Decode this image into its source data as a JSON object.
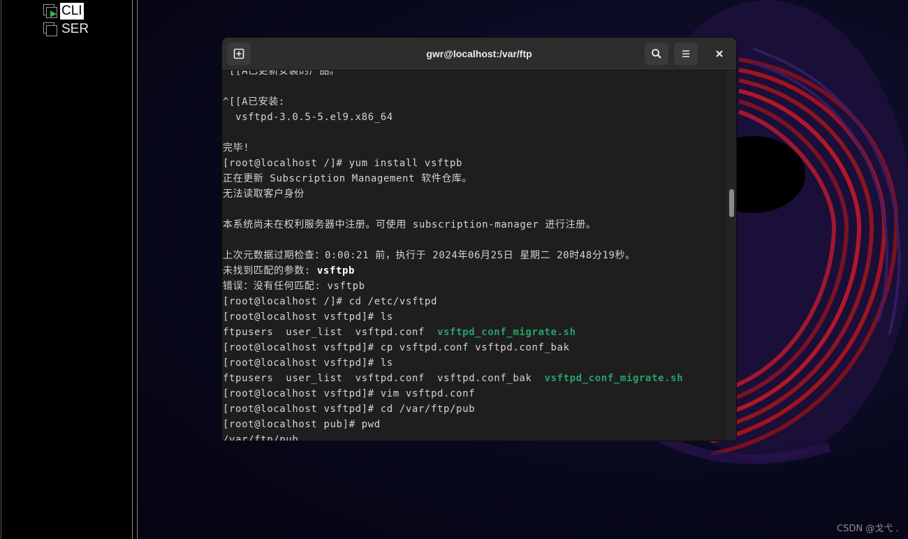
{
  "vm_list": [
    {
      "label": "CLI",
      "selected": true,
      "running": true
    },
    {
      "label": "SER",
      "selected": false,
      "running": false
    }
  ],
  "terminal": {
    "title": "gwr@localhost:/var/ftp",
    "lines": [
      [
        {
          "t": "^[[A已更新安装的产品。"
        }
      ],
      [
        {
          "t": ""
        }
      ],
      [
        {
          "t": "^[[A已安装:"
        }
      ],
      [
        {
          "t": "  vsftpd-3.0.5-5.el9.x86_64"
        }
      ],
      [
        {
          "t": ""
        }
      ],
      [
        {
          "t": "完毕!"
        }
      ],
      [
        {
          "t": "[root@localhost /]# yum install vsftpb"
        }
      ],
      [
        {
          "t": "正在更新 Subscription Management 软件仓库。"
        }
      ],
      [
        {
          "t": "无法读取客户身份"
        }
      ],
      [
        {
          "t": ""
        }
      ],
      [
        {
          "t": "本系统尚未在权利服务器中注册。可使用 subscription-manager 进行注册。"
        }
      ],
      [
        {
          "t": ""
        }
      ],
      [
        {
          "t": "上次元数据过期检查：0:00:21 前，执行于 2024年06月25日 星期二 20时48分19秒。"
        }
      ],
      [
        {
          "t": "未找到匹配的参数: "
        },
        {
          "t": "vsftpb",
          "c": "bold"
        }
      ],
      [
        {
          "t": "错误：没有任何匹配: vsftpb"
        }
      ],
      [
        {
          "t": "[root@localhost /]# cd /etc/vsftpd"
        }
      ],
      [
        {
          "t": "[root@localhost vsftpd]# ls"
        }
      ],
      [
        {
          "t": "ftpusers  user_list  vsftpd.conf  "
        },
        {
          "t": "vsftpd_conf_migrate.sh",
          "c": "hl"
        }
      ],
      [
        {
          "t": "[root@localhost vsftpd]# cp vsftpd.conf vsftpd.conf_bak"
        }
      ],
      [
        {
          "t": "[root@localhost vsftpd]# ls"
        }
      ],
      [
        {
          "t": "ftpusers  user_list  vsftpd.conf  vsftpd.conf_bak  "
        },
        {
          "t": "vsftpd_conf_migrate.sh",
          "c": "hl"
        }
      ],
      [
        {
          "t": "[root@localhost vsftpd]# vim vsftpd.conf"
        }
      ],
      [
        {
          "t": "[root@localhost vsftpd]# cd /var/ftp/pub"
        }
      ],
      [
        {
          "t": "[root@localhost pub]# pwd"
        }
      ],
      [
        {
          "t": "/var/ftp/pub"
        }
      ]
    ]
  },
  "icons": {
    "new_tab": "new-tab-icon",
    "search": "search-icon",
    "menu": "hamburger-menu-icon",
    "close": "close-icon"
  },
  "watermark": "CSDN @戈弋 .",
  "colors": {
    "highlight_green": "#26a269",
    "terminal_bg": "#1e1e1e",
    "titlebar_bg": "#2d2d2d"
  }
}
